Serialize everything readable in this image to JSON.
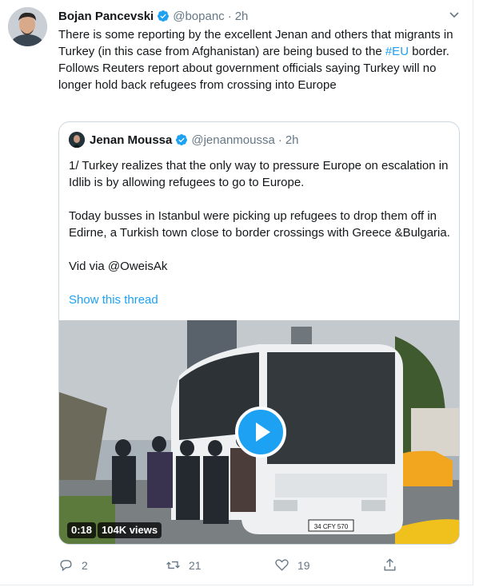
{
  "tweet": {
    "author_name": "Bojan Pancevski",
    "author_handle": "@bopanc",
    "separator": "·",
    "time": "2h",
    "text_part1": "There is some reporting by the excellent Jenan and others that migrants in Turkey (in this case from Afghanistan) are being bused to the ",
    "hashtag": "#EU",
    "text_part2": " border. Follows Reuters report about government officials saying Turkey will no longer hold back refugees from crossing into Europe"
  },
  "quote": {
    "author_name": "Jenan Moussa",
    "author_handle": "@jenanmoussa",
    "separator": "·",
    "time": "2h",
    "paragraph1": "1/ Turkey realizes that the only way to pressure Europe on escalation in Idlib is by allowing refugees to go to Europe.",
    "paragraph2": "Today busses in Istanbul were picking up refugees to drop them off in Edirne, a Turkish town close to border crossings with Greece &Bulgaria.",
    "paragraph3": "Vid via @OweisAk",
    "show_thread": "Show this thread",
    "video_duration": "0:18",
    "video_views": "104K views",
    "bus_plate": "34 CFY 570"
  },
  "actions": {
    "reply_count": "2",
    "retweet_count": "21",
    "like_count": "19"
  },
  "colors": {
    "accent": "#1da1f2",
    "muted": "#657786",
    "text": "#14171a",
    "border": "#ccd6dd"
  },
  "icons": {
    "verified": "verified-badge-icon",
    "caret": "chevron-down-icon",
    "reply": "reply-icon",
    "retweet": "retweet-icon",
    "like": "heart-icon",
    "share": "share-icon",
    "play": "play-icon"
  }
}
